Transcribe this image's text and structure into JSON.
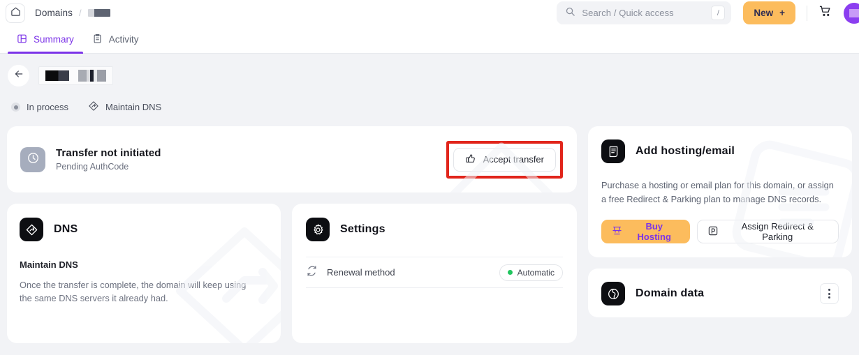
{
  "topbar": {
    "home_icon": "home-icon",
    "breadcrumb_root": "Domains",
    "breadcrumb_separator": "/",
    "breadcrumb_current": "",
    "search": {
      "placeholder": "Search / Quick access",
      "shortcut_key": "/",
      "icon": "search-icon"
    },
    "new_button": {
      "label": "New",
      "plus": "+",
      "bg": "#fcbc5d",
      "fg": "#2f2d52"
    },
    "cart_icon": "shopping-cart-icon",
    "avatar": {
      "icon": "user-avatar",
      "bg": "#8b3ef0"
    }
  },
  "tabs": [
    {
      "label": "Summary",
      "icon": "layout-panel-icon",
      "active": true
    },
    {
      "label": "Activity",
      "icon": "clipboard-list-icon",
      "active": false
    }
  ],
  "accent": {
    "purple": "#7c34e8",
    "orange": "#fcbc5d",
    "green": "#20c55e",
    "highlight_red": "#e1251b"
  },
  "domain_header": {
    "back_icon": "arrow-left-icon",
    "domain_name": "",
    "statuses": [
      {
        "label": "In process",
        "icon": "status-dot-icon"
      },
      {
        "label": "Maintain DNS",
        "icon": "dns-diamond-icon"
      }
    ]
  },
  "transfer_card": {
    "icon": "clock-icon",
    "title": "Transfer not initiated",
    "subtitle": "Pending AuthCode",
    "action": {
      "label": "Accept transfer",
      "icon": "thumbs-up-icon",
      "highlighted": true
    }
  },
  "dns_card": {
    "icon": "dns-diamond-icon",
    "title": "DNS",
    "subtitle": "Maintain DNS",
    "body": "Once the transfer is complete, the domain will keep using the same DNS servers it already had."
  },
  "settings_card": {
    "icon": "gear-icon",
    "title": "Settings",
    "rows": [
      {
        "label": "Renewal method",
        "icon": "refresh-cycle-icon",
        "badge": {
          "text": "Automatic",
          "dot_color": "#20c55e"
        }
      }
    ]
  },
  "hosting_card": {
    "icon": "document-hosting-icon",
    "title": "Add hosting/email",
    "description": "Purchase a hosting or email plan for this domain, or assign a free Redirect & Parking plan to manage DNS records.",
    "buttons": [
      {
        "label": "Buy Hosting",
        "icon": "server-icon",
        "style": "primary"
      },
      {
        "label": "Assign Redirect & Parking",
        "icon": "parking-icon",
        "style": "secondary"
      }
    ]
  },
  "domain_data_card": {
    "icon": "globe-icon",
    "title": "Domain data",
    "menu_icon": "kebab-menu-icon"
  }
}
